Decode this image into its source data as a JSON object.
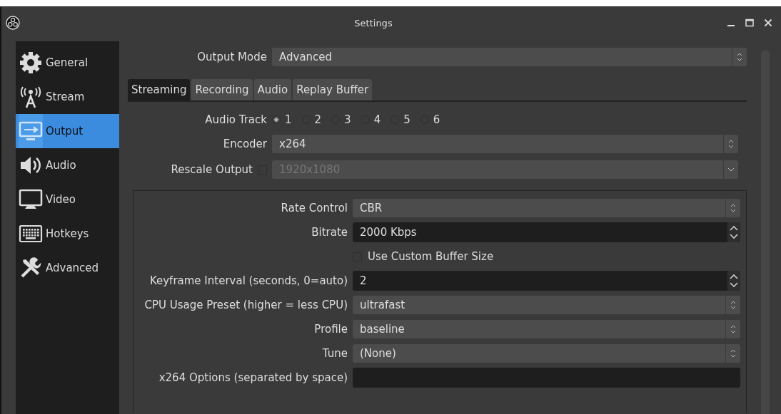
{
  "window": {
    "title": "Settings"
  },
  "sidebar": {
    "items": [
      {
        "label": "General",
        "selected": false
      },
      {
        "label": "Stream",
        "selected": false
      },
      {
        "label": "Output",
        "selected": true
      },
      {
        "label": "Audio",
        "selected": false
      },
      {
        "label": "Video",
        "selected": false
      },
      {
        "label": "Hotkeys",
        "selected": false
      },
      {
        "label": "Advanced",
        "selected": false
      }
    ]
  },
  "output_mode": {
    "label": "Output Mode",
    "value": "Advanced"
  },
  "tabs": [
    {
      "label": "Streaming",
      "selected": true
    },
    {
      "label": "Recording",
      "selected": false
    },
    {
      "label": "Audio",
      "selected": false
    },
    {
      "label": "Replay Buffer",
      "selected": false
    }
  ],
  "audio_track": {
    "label": "Audio Track",
    "options": [
      {
        "label": "1",
        "selected": true
      },
      {
        "label": "2",
        "selected": false
      },
      {
        "label": "3",
        "selected": false
      },
      {
        "label": "4",
        "selected": false
      },
      {
        "label": "5",
        "selected": false
      },
      {
        "label": "6",
        "selected": false
      }
    ]
  },
  "encoder": {
    "label": "Encoder",
    "value": "x264"
  },
  "rescale": {
    "label": "Rescale Output",
    "checked": false,
    "value": "1920x1080",
    "disabled": true
  },
  "rows": [
    {
      "kind": "combo",
      "label": "Rate Control",
      "value": "CBR"
    },
    {
      "kind": "spin",
      "label": "Bitrate",
      "value": "2000 Kbps"
    },
    {
      "kind": "checkbox",
      "label": "Use Custom Buffer Size",
      "checked": false
    },
    {
      "kind": "spin",
      "label": "Keyframe Interval (seconds, 0=auto)",
      "value": "2"
    },
    {
      "kind": "combo",
      "label": "CPU Usage Preset (higher = less CPU)",
      "value": "ultrafast"
    },
    {
      "kind": "combo",
      "label": "Profile",
      "value": "baseline"
    },
    {
      "kind": "combo",
      "label": "Tune",
      "value": "(None)"
    },
    {
      "kind": "text",
      "label": "x264 Options (separated by space)"
    }
  ]
}
